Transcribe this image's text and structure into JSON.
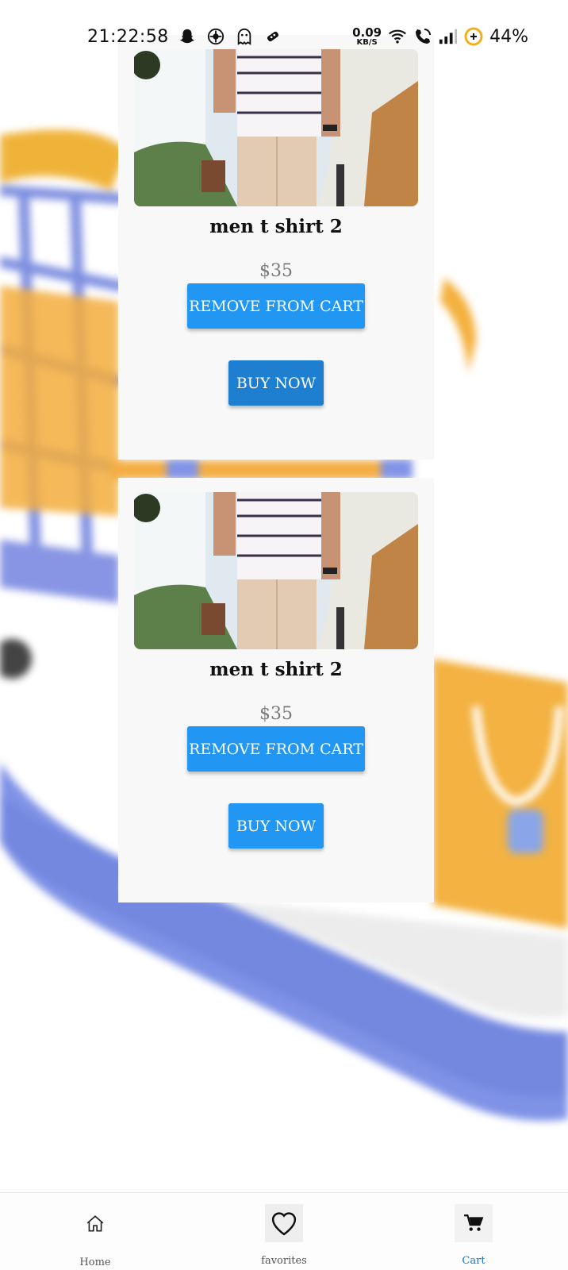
{
  "status_bar": {
    "time": "21:22:58",
    "net_speed_value": "0.09",
    "net_speed_unit": "KB/S",
    "battery": "44%",
    "icons": [
      "snapchat-icon",
      "vpn-icon",
      "ghost-icon",
      "game-icon",
      "wifi-icon",
      "wifi-call-icon",
      "signal-icon",
      "battery-saver-icon"
    ]
  },
  "cart": {
    "items": [
      {
        "title": "men t shirt 2",
        "price": "$35",
        "remove_label": "REMOVE FROM CART",
        "buy_label": "BUY NOW"
      },
      {
        "title": "men t shirt 2",
        "price": "$35",
        "remove_label": "REMOVE FROM CART",
        "buy_label": "BUY NOW"
      }
    ]
  },
  "bottom_nav": {
    "items": [
      {
        "label": "Home",
        "icon": "home-icon"
      },
      {
        "label": "favorites",
        "icon": "heart-icon"
      },
      {
        "label": "Cart",
        "icon": "cart-icon",
        "active": true
      }
    ]
  },
  "colors": {
    "accent": "#2196f3",
    "active_nav": "#1976d2",
    "card_bg": "#f8f8f8",
    "price": "#7a7a7a"
  }
}
